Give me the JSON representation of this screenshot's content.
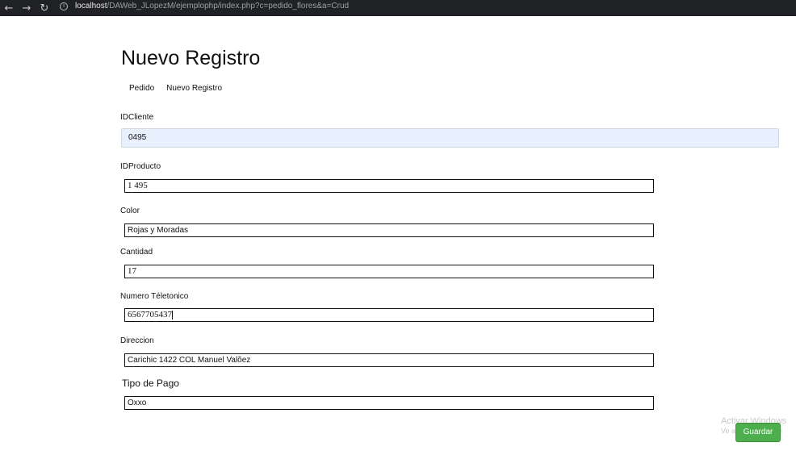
{
  "browser": {
    "back": "←",
    "forward": "→",
    "reload": "↻",
    "url_host": "localhost",
    "url_path": "/DAWeb_JLopezM/ejemplophp/index.php?c=pedido_flores&a=Crud"
  },
  "page": {
    "title": "Nuevo Registro",
    "breadcrumb": [
      "Pedido",
      "Nuevo Registro"
    ]
  },
  "form": {
    "idcliente": {
      "label": "IDCliente",
      "value": "0495"
    },
    "idproducto": {
      "label": "IDProducto",
      "value": "1 495"
    },
    "color": {
      "label": "Color",
      "value": "Rojas y Moradas"
    },
    "cantidad": {
      "label": "Cantidad",
      "value": "17"
    },
    "telefono": {
      "label": "Numero Téletonico",
      "value": "6567705437"
    },
    "direccion": {
      "label": "Direccion",
      "value": "Carichic 1422 COL Manuel Valõez"
    },
    "tipo_pago": {
      "label": "Tipo de Pago",
      "value": "Oxxo"
    },
    "save_label": "Guardar"
  },
  "watermark": {
    "line1": "Activar Windows",
    "line2": "Ve a Configuración"
  }
}
